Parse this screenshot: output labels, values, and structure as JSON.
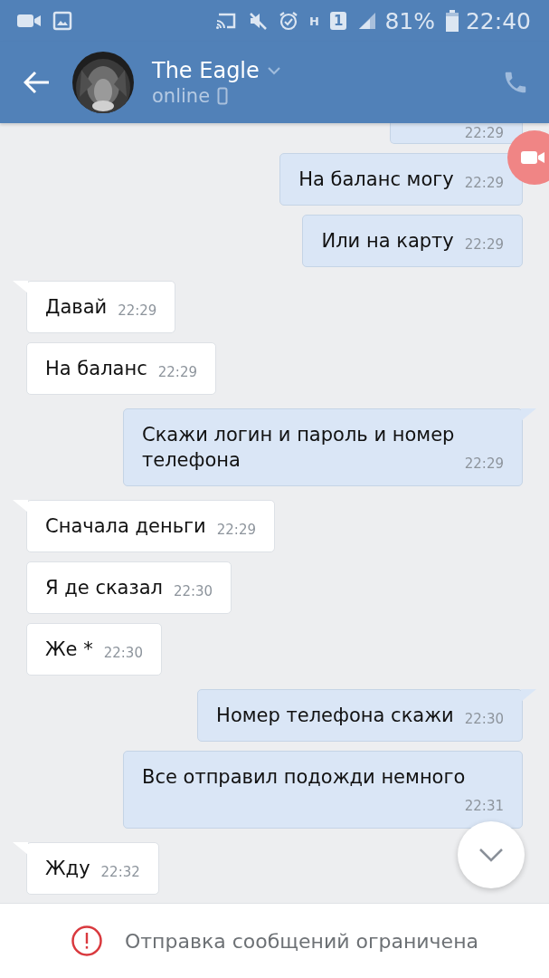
{
  "status_bar": {
    "network": "H",
    "sim": "1",
    "battery": "81%",
    "time": "22:40"
  },
  "header": {
    "name": "The Eagle",
    "status": "online"
  },
  "messages": [
    {
      "kind": "outgoing",
      "clipped": true,
      "tail": false,
      "time": "22:29"
    },
    {
      "kind": "outgoing",
      "clipped": false,
      "tail": false,
      "text": "На баланс могу",
      "time": "22:29"
    },
    {
      "kind": "outgoing",
      "clipped": false,
      "tail": false,
      "text": "Или на карту",
      "time": "22:29"
    },
    {
      "kind": "incoming",
      "clipped": false,
      "tail": true,
      "text": "Давай",
      "time": "22:29"
    },
    {
      "kind": "incoming",
      "clipped": false,
      "tail": false,
      "text": "На баланс",
      "time": "22:29"
    },
    {
      "kind": "outgoing",
      "clipped": false,
      "tail": true,
      "text": "Скажи логин и пароль и номер телефона",
      "time": "22:29"
    },
    {
      "kind": "incoming",
      "clipped": false,
      "tail": true,
      "text": "Сначала деньги",
      "time": "22:29"
    },
    {
      "kind": "incoming",
      "clipped": false,
      "tail": false,
      "text": "Я де сказал",
      "time": "22:30"
    },
    {
      "kind": "incoming",
      "clipped": false,
      "tail": false,
      "text": "Же *",
      "time": "22:30"
    },
    {
      "kind": "outgoing",
      "clipped": false,
      "tail": true,
      "text": "Номер телефона скажи",
      "time": "22:30"
    },
    {
      "kind": "outgoing",
      "clipped": false,
      "tail": false,
      "text": "Все отправил подожди немного",
      "time": "22:31"
    },
    {
      "kind": "incoming",
      "clipped": false,
      "tail": true,
      "text": "Жду",
      "time": "22:32"
    }
  ],
  "notice": "Отправка сообщений ограничена"
}
